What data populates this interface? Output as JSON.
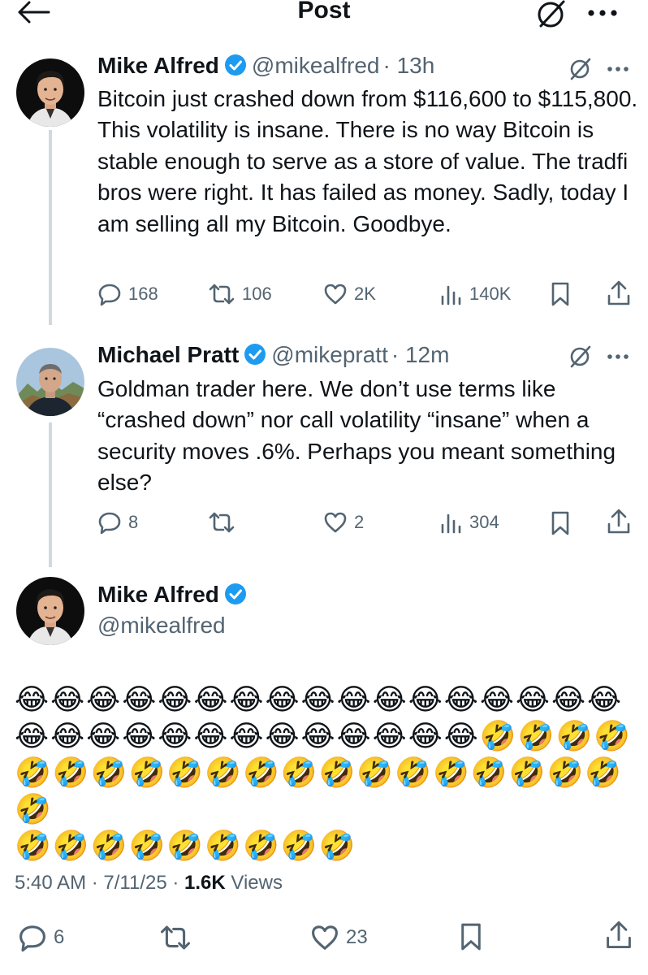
{
  "header": {
    "title": "Post"
  },
  "tweets": [
    {
      "name": "Mike Alfred",
      "handle": "@mikealfred",
      "time": "· 13h",
      "text": "Bitcoin just crashed down from $116,600 to $115,800. This volatility is insane. There is no way Bitcoin is stable enough to serve as a store of value. The tradfi bros were right. It has failed as money. Sadly, today I am selling all my Bitcoin. Goodbye.",
      "replies": "168",
      "retweets": "106",
      "likes": "2K",
      "views": "140K"
    },
    {
      "name": "Michael Pratt",
      "handle": "@mikepratt",
      "time": "· 12m",
      "text": "Goldman trader here. We don’t use terms like “crashed down” nor call volatility “insane” when a security moves .6%. Perhaps you meant something else?",
      "replies": "8",
      "retweets": "",
      "likes": "2",
      "views": "304"
    }
  ],
  "main_post": {
    "name": "Mike Alfred",
    "handle": "@mikealfred",
    "emoji_line1": "😂😂😂😂😂😂😂😂😂😂😂😂😂😂😂😂😂",
    "emoji_line2": "😂😂😂😂😂😂😂😂😂😂😂😂😂🤣🤣🤣🤣",
    "emoji_line3": "🤣🤣🤣🤣🤣🤣🤣🤣🤣🤣🤣🤣🤣🤣🤣🤣🤣",
    "emoji_line4": "🤣🤣🤣🤣🤣🤣🤣🤣🤣",
    "time": "5:40 AM · 7/11/25 · ",
    "views_count": "1.6K",
    "views_label": " Views",
    "replies": "6",
    "retweets": "",
    "likes": "23"
  },
  "colors": {
    "text": "#0f1419",
    "secondary": "#536471",
    "verified": "#1d9bf0",
    "thread_line": "#cfd9de"
  },
  "icons": [
    "back-arrow-icon",
    "grok-icon",
    "more-icon",
    "verified-badge-icon",
    "reply-icon",
    "retweet-icon",
    "like-icon",
    "views-icon",
    "bookmark-icon",
    "share-icon"
  ]
}
